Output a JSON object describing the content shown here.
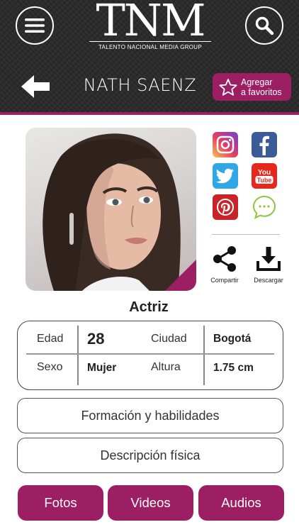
{
  "header": {
    "logo_mark": "TNM",
    "logo_subtitle": "TALENTO NACIONAL MEDIA GROUP",
    "profile_name": "NATH SAENZ",
    "favorite_label_line1": "Agregar",
    "favorite_label_line2": "a favoritos"
  },
  "social": [
    "instagram-icon",
    "facebook-icon",
    "twitter-icon",
    "youtube-icon",
    "pinterest-icon",
    "message-icon"
  ],
  "actions": {
    "share_label": "Compartir",
    "download_label": "Descargar"
  },
  "profile": {
    "role": "Actriz",
    "age_label": "Edad",
    "age_value": "28",
    "city_label": "Ciudad",
    "city_value": "Bogotá",
    "sex_label": "Sexo",
    "sex_value": "Mujer",
    "height_label": "Altura",
    "height_value": "1.75 cm"
  },
  "sections": {
    "skills": "Formación y habilidades",
    "physical": "Descripción física"
  },
  "tabs": {
    "photos": "Fotos",
    "videos": "Videos",
    "audios": "Audios"
  },
  "colors": {
    "accent": "#9c1e63",
    "header_bg": "#2b2b2b"
  }
}
